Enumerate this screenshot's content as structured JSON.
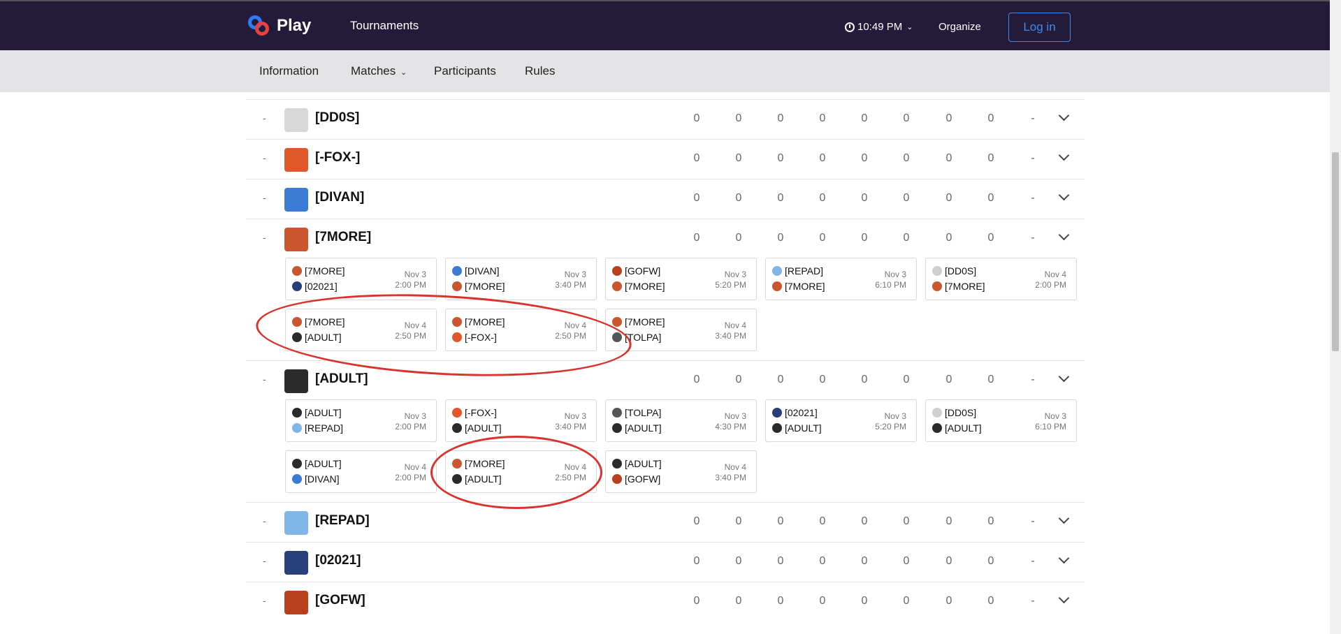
{
  "header": {
    "brand": "Play",
    "nav_tournaments": "Tournaments",
    "time": "10:49 PM",
    "organize": "Organize",
    "login": "Log in"
  },
  "subnav": {
    "tabs": [
      "Information",
      "Matches",
      "Participants",
      "Rules"
    ]
  },
  "teams": [
    {
      "rank": "-",
      "name": "[DD0S]",
      "stats": [
        "0",
        "0",
        "0",
        "0",
        "0",
        "0",
        "0",
        "0",
        "-"
      ],
      "color": "#d8d8d8"
    },
    {
      "rank": "-",
      "name": "[-FOX-]",
      "stats": [
        "0",
        "0",
        "0",
        "0",
        "0",
        "0",
        "0",
        "0",
        "-"
      ],
      "color": "#e0572a"
    },
    {
      "rank": "-",
      "name": "[DIVAN]",
      "stats": [
        "0",
        "0",
        "0",
        "0",
        "0",
        "0",
        "0",
        "0",
        "-"
      ],
      "color": "#3c7bd4"
    },
    {
      "rank": "-",
      "name": "[7MORE]",
      "stats": [
        "0",
        "0",
        "0",
        "0",
        "0",
        "0",
        "0",
        "0",
        "-"
      ],
      "color": "#c9562f"
    },
    {
      "rank": "-",
      "name": "[ADULT]",
      "stats": [
        "0",
        "0",
        "0",
        "0",
        "0",
        "0",
        "0",
        "0",
        "-"
      ],
      "color": "#2b2b2b"
    },
    {
      "rank": "-",
      "name": "[REPAD]",
      "stats": [
        "0",
        "0",
        "0",
        "0",
        "0",
        "0",
        "0",
        "0",
        "-"
      ],
      "color": "#7fb6e6"
    },
    {
      "rank": "-",
      "name": "[02021]",
      "stats": [
        "0",
        "0",
        "0",
        "0",
        "0",
        "0",
        "0",
        "0",
        "-"
      ],
      "color": "#27407a"
    },
    {
      "rank": "-",
      "name": "[GOFW]",
      "stats": [
        "0",
        "0",
        "0",
        "0",
        "0",
        "0",
        "0",
        "0",
        "-"
      ],
      "color": "#b8401c"
    }
  ],
  "matches_7more": [
    {
      "t1": "[7MORE]",
      "t2": "[02021]",
      "date": "Nov 3",
      "time": "2:00 PM",
      "c1": "#c9562f",
      "c2": "#27407a"
    },
    {
      "t1": "[DIVAN]",
      "t2": "[7MORE]",
      "date": "Nov 3",
      "time": "3:40 PM",
      "c1": "#3c7bd4",
      "c2": "#c9562f"
    },
    {
      "t1": "[GOFW]",
      "t2": "[7MORE]",
      "date": "Nov 3",
      "time": "5:20 PM",
      "c1": "#b8401c",
      "c2": "#c9562f"
    },
    {
      "t1": "[REPAD]",
      "t2": "[7MORE]",
      "date": "Nov 3",
      "time": "6:10 PM",
      "c1": "#7fb6e6",
      "c2": "#c9562f"
    },
    {
      "t1": "[DD0S]",
      "t2": "[7MORE]",
      "date": "Nov 4",
      "time": "2:00 PM",
      "c1": "#cfcfcf",
      "c2": "#c9562f"
    },
    {
      "t1": "[7MORE]",
      "t2": "[ADULT]",
      "date": "Nov 4",
      "time": "2:50 PM",
      "c1": "#c9562f",
      "c2": "#2b2b2b"
    },
    {
      "t1": "[7MORE]",
      "t2": "[-FOX-]",
      "date": "Nov 4",
      "time": "2:50 PM",
      "c1": "#c9562f",
      "c2": "#e0572a"
    },
    {
      "t1": "[7MORE]",
      "t2": "[TOLPA]",
      "date": "Nov 4",
      "time": "3:40 PM",
      "c1": "#c9562f",
      "c2": "#555555"
    }
  ],
  "matches_adult": [
    {
      "t1": "[ADULT]",
      "t2": "[REPAD]",
      "date": "Nov 3",
      "time": "2:00 PM",
      "c1": "#2b2b2b",
      "c2": "#7fb6e6"
    },
    {
      "t1": "[-FOX-]",
      "t2": "[ADULT]",
      "date": "Nov 3",
      "time": "3:40 PM",
      "c1": "#e0572a",
      "c2": "#2b2b2b"
    },
    {
      "t1": "[TOLPA]",
      "t2": "[ADULT]",
      "date": "Nov 3",
      "time": "4:30 PM",
      "c1": "#555555",
      "c2": "#2b2b2b"
    },
    {
      "t1": "[02021]",
      "t2": "[ADULT]",
      "date": "Nov 3",
      "time": "5:20 PM",
      "c1": "#27407a",
      "c2": "#2b2b2b"
    },
    {
      "t1": "[DD0S]",
      "t2": "[ADULT]",
      "date": "Nov 3",
      "time": "6:10 PM",
      "c1": "#cfcfcf",
      "c2": "#2b2b2b"
    },
    {
      "t1": "[ADULT]",
      "t2": "[DIVAN]",
      "date": "Nov 4",
      "time": "2:00 PM",
      "c1": "#2b2b2b",
      "c2": "#3c7bd4"
    },
    {
      "t1": "[7MORE]",
      "t2": "[ADULT]",
      "date": "Nov 4",
      "time": "2:50 PM",
      "c1": "#c9562f",
      "c2": "#2b2b2b"
    },
    {
      "t1": "[ADULT]",
      "t2": "[GOFW]",
      "date": "Nov 4",
      "time": "3:40 PM",
      "c1": "#2b2b2b",
      "c2": "#b8401c"
    }
  ],
  "colors": {
    "topbar": "#241a3a",
    "accent": "#3b8cf0",
    "annotation": "#d9332e"
  }
}
